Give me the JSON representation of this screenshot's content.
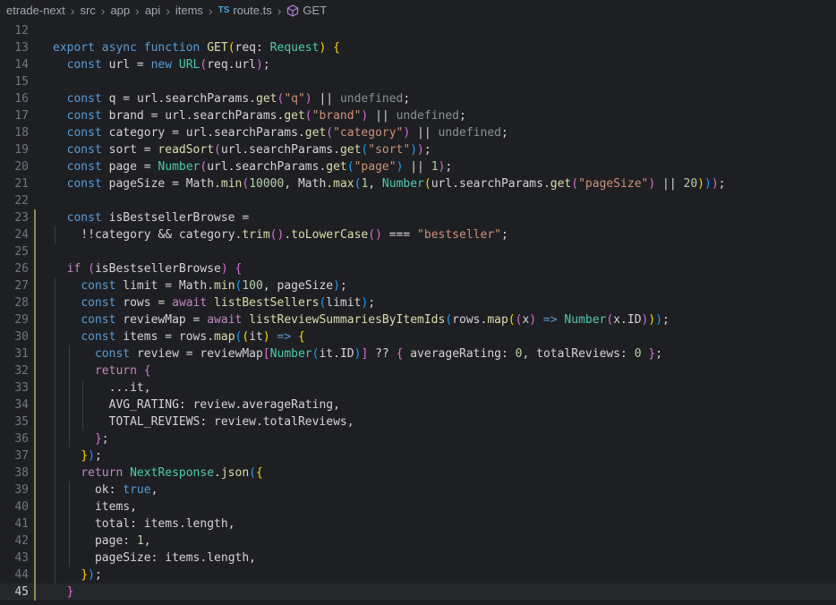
{
  "breadcrumb": {
    "segments": [
      "etrade-next",
      "src",
      "app",
      "api",
      "items",
      "route.ts",
      "GET"
    ],
    "file_badge": "TS"
  },
  "editor": {
    "current_line": 45,
    "lines": [
      {
        "n": "12",
        "tokens": []
      },
      {
        "n": "13",
        "tokens": [
          [
            "k",
            "export "
          ],
          [
            "k",
            "async "
          ],
          [
            "k",
            "function "
          ],
          [
            "f",
            "GET"
          ],
          [
            "b1",
            "("
          ],
          [
            "v",
            "req"
          ],
          [
            "o",
            ": "
          ],
          [
            "c",
            "Request"
          ],
          [
            "b1",
            ")"
          ],
          [
            "o",
            " "
          ],
          [
            "b1",
            "{"
          ]
        ]
      },
      {
        "n": "14",
        "tokens": [
          [
            "o",
            "  "
          ],
          [
            "k",
            "const "
          ],
          [
            "v",
            "url"
          ],
          [
            "o",
            " = "
          ],
          [
            "k",
            "new "
          ],
          [
            "c",
            "URL"
          ],
          [
            "b2",
            "("
          ],
          [
            "v",
            "req.url"
          ],
          [
            "b2",
            ")"
          ],
          [
            "o",
            ";"
          ]
        ]
      },
      {
        "n": "15",
        "tokens": []
      },
      {
        "n": "16",
        "tokens": [
          [
            "o",
            "  "
          ],
          [
            "k",
            "const "
          ],
          [
            "v",
            "q"
          ],
          [
            "o",
            " = "
          ],
          [
            "v",
            "url.searchParams."
          ],
          [
            "f",
            "get"
          ],
          [
            "b2",
            "("
          ],
          [
            "s",
            "\"q\""
          ],
          [
            "b2",
            ")"
          ],
          [
            "o",
            " || "
          ],
          [
            "m",
            "undefined"
          ],
          [
            "o",
            ";"
          ]
        ]
      },
      {
        "n": "17",
        "tokens": [
          [
            "o",
            "  "
          ],
          [
            "k",
            "const "
          ],
          [
            "v",
            "brand"
          ],
          [
            "o",
            " = "
          ],
          [
            "v",
            "url.searchParams."
          ],
          [
            "f",
            "get"
          ],
          [
            "b2",
            "("
          ],
          [
            "s",
            "\"brand\""
          ],
          [
            "b2",
            ")"
          ],
          [
            "o",
            " || "
          ],
          [
            "m",
            "undefined"
          ],
          [
            "o",
            ";"
          ]
        ]
      },
      {
        "n": "18",
        "tokens": [
          [
            "o",
            "  "
          ],
          [
            "k",
            "const "
          ],
          [
            "v",
            "category"
          ],
          [
            "o",
            " = "
          ],
          [
            "v",
            "url.searchParams."
          ],
          [
            "f",
            "get"
          ],
          [
            "b2",
            "("
          ],
          [
            "s",
            "\"category\""
          ],
          [
            "b2",
            ")"
          ],
          [
            "o",
            " || "
          ],
          [
            "m",
            "undefined"
          ],
          [
            "o",
            ";"
          ]
        ]
      },
      {
        "n": "19",
        "tokens": [
          [
            "o",
            "  "
          ],
          [
            "k",
            "const "
          ],
          [
            "v",
            "sort"
          ],
          [
            "o",
            " = "
          ],
          [
            "f",
            "readSort"
          ],
          [
            "b2",
            "("
          ],
          [
            "v",
            "url.searchParams."
          ],
          [
            "f",
            "get"
          ],
          [
            "b3",
            "("
          ],
          [
            "s",
            "\"sort\""
          ],
          [
            "b3",
            ")"
          ],
          [
            "b2",
            ")"
          ],
          [
            "o",
            ";"
          ]
        ]
      },
      {
        "n": "20",
        "tokens": [
          [
            "o",
            "  "
          ],
          [
            "k",
            "const "
          ],
          [
            "v",
            "page"
          ],
          [
            "o",
            " = "
          ],
          [
            "c",
            "Number"
          ],
          [
            "b2",
            "("
          ],
          [
            "v",
            "url.searchParams."
          ],
          [
            "f",
            "get"
          ],
          [
            "b3",
            "("
          ],
          [
            "s",
            "\"page\""
          ],
          [
            "b3",
            ")"
          ],
          [
            "o",
            " || "
          ],
          [
            "n",
            "1"
          ],
          [
            "b2",
            ")"
          ],
          [
            "o",
            ";"
          ]
        ]
      },
      {
        "n": "21",
        "tokens": [
          [
            "o",
            "  "
          ],
          [
            "k",
            "const "
          ],
          [
            "v",
            "pageSize"
          ],
          [
            "o",
            " = "
          ],
          [
            "v",
            "Math."
          ],
          [
            "f",
            "min"
          ],
          [
            "b2",
            "("
          ],
          [
            "n",
            "10000"
          ],
          [
            "o",
            ", "
          ],
          [
            "v",
            "Math."
          ],
          [
            "f",
            "max"
          ],
          [
            "b3",
            "("
          ],
          [
            "n",
            "1"
          ],
          [
            "o",
            ", "
          ],
          [
            "c",
            "Number"
          ],
          [
            "b1",
            "("
          ],
          [
            "v",
            "url.searchParams."
          ],
          [
            "f",
            "get"
          ],
          [
            "b2",
            "("
          ],
          [
            "s",
            "\"pageSize\""
          ],
          [
            "b2",
            ")"
          ],
          [
            "o",
            " || "
          ],
          [
            "n",
            "20"
          ],
          [
            "b1",
            ")"
          ],
          [
            "b3",
            ")"
          ],
          [
            "b2",
            ")"
          ],
          [
            "o",
            ";"
          ]
        ]
      },
      {
        "n": "22",
        "tokens": []
      },
      {
        "n": "23",
        "tokens": [
          [
            "o",
            "  "
          ],
          [
            "k",
            "const "
          ],
          [
            "v",
            "isBestsellerBrowse"
          ],
          [
            "o",
            " ="
          ]
        ]
      },
      {
        "n": "24",
        "tokens": [
          [
            "o",
            "    "
          ],
          [
            "o",
            "!!"
          ],
          [
            "v",
            "category"
          ],
          [
            "o",
            " && "
          ],
          [
            "v",
            "category."
          ],
          [
            "f",
            "trim"
          ],
          [
            "b2",
            "()"
          ],
          [
            "o",
            "."
          ],
          [
            "f",
            "toLowerCase"
          ],
          [
            "b2",
            "()"
          ],
          [
            "o",
            " === "
          ],
          [
            "s",
            "\"bestseller\""
          ],
          [
            "o",
            ";"
          ]
        ]
      },
      {
        "n": "25",
        "tokens": []
      },
      {
        "n": "26",
        "tokens": [
          [
            "o",
            "  "
          ],
          [
            "kw2",
            "if "
          ],
          [
            "b2",
            "("
          ],
          [
            "v",
            "isBestsellerBrowse"
          ],
          [
            "b2",
            ")"
          ],
          [
            "o",
            " "
          ],
          [
            "b2",
            "{"
          ]
        ]
      },
      {
        "n": "27",
        "tokens": [
          [
            "o",
            "    "
          ],
          [
            "k",
            "const "
          ],
          [
            "v",
            "limit"
          ],
          [
            "o",
            " = "
          ],
          [
            "v",
            "Math."
          ],
          [
            "f",
            "min"
          ],
          [
            "b3",
            "("
          ],
          [
            "n",
            "100"
          ],
          [
            "o",
            ", "
          ],
          [
            "v",
            "pageSize"
          ],
          [
            "b3",
            ")"
          ],
          [
            "o",
            ";"
          ]
        ]
      },
      {
        "n": "28",
        "tokens": [
          [
            "o",
            "    "
          ],
          [
            "k",
            "const "
          ],
          [
            "v",
            "rows"
          ],
          [
            "o",
            " = "
          ],
          [
            "kw2",
            "await "
          ],
          [
            "f",
            "listBestSellers"
          ],
          [
            "b3",
            "("
          ],
          [
            "v",
            "limit"
          ],
          [
            "b3",
            ")"
          ],
          [
            "o",
            ";"
          ]
        ]
      },
      {
        "n": "29",
        "tokens": [
          [
            "o",
            "    "
          ],
          [
            "k",
            "const "
          ],
          [
            "v",
            "reviewMap"
          ],
          [
            "o",
            " = "
          ],
          [
            "kw2",
            "await "
          ],
          [
            "f",
            "listReviewSummariesByItemIds"
          ],
          [
            "b3",
            "("
          ],
          [
            "v",
            "rows."
          ],
          [
            "f",
            "map"
          ],
          [
            "b1",
            "("
          ],
          [
            "b2",
            "("
          ],
          [
            "v",
            "x"
          ],
          [
            "b2",
            ")"
          ],
          [
            "k",
            " => "
          ],
          [
            "c",
            "Number"
          ],
          [
            "b2",
            "("
          ],
          [
            "v",
            "x.ID"
          ],
          [
            "b2",
            ")"
          ],
          [
            "b1",
            ")"
          ],
          [
            "b3",
            ")"
          ],
          [
            "o",
            ";"
          ]
        ]
      },
      {
        "n": "30",
        "tokens": [
          [
            "o",
            "    "
          ],
          [
            "k",
            "const "
          ],
          [
            "v",
            "items"
          ],
          [
            "o",
            " = "
          ],
          [
            "v",
            "rows."
          ],
          [
            "f",
            "map"
          ],
          [
            "b3",
            "("
          ],
          [
            "b1",
            "("
          ],
          [
            "v",
            "it"
          ],
          [
            "b1",
            ")"
          ],
          [
            "k",
            " => "
          ],
          [
            "b1",
            "{"
          ]
        ]
      },
      {
        "n": "31",
        "tokens": [
          [
            "o",
            "      "
          ],
          [
            "k",
            "const "
          ],
          [
            "v",
            "review"
          ],
          [
            "o",
            " = "
          ],
          [
            "v",
            "reviewMap"
          ],
          [
            "b2",
            "["
          ],
          [
            "c",
            "Number"
          ],
          [
            "b3",
            "("
          ],
          [
            "v",
            "it.ID"
          ],
          [
            "b3",
            ")"
          ],
          [
            "b2",
            "]"
          ],
          [
            "o",
            " ?? "
          ],
          [
            "b2",
            "{ "
          ],
          [
            "v",
            "averageRating"
          ],
          [
            "o",
            ": "
          ],
          [
            "n",
            "0"
          ],
          [
            "o",
            ", "
          ],
          [
            "v",
            "totalReviews"
          ],
          [
            "o",
            ": "
          ],
          [
            "n",
            "0"
          ],
          [
            "b2",
            " }"
          ],
          [
            "o",
            ";"
          ]
        ]
      },
      {
        "n": "32",
        "tokens": [
          [
            "o",
            "      "
          ],
          [
            "kw2",
            "return "
          ],
          [
            "b2",
            "{"
          ]
        ]
      },
      {
        "n": "33",
        "tokens": [
          [
            "o",
            "        "
          ],
          [
            "o",
            "..."
          ],
          [
            "v",
            "it"
          ],
          [
            "o",
            ","
          ]
        ]
      },
      {
        "n": "34",
        "tokens": [
          [
            "o",
            "        "
          ],
          [
            "v",
            "AVG_RATING"
          ],
          [
            "o",
            ": "
          ],
          [
            "v",
            "review.averageRating"
          ],
          [
            "o",
            ","
          ]
        ]
      },
      {
        "n": "35",
        "tokens": [
          [
            "o",
            "        "
          ],
          [
            "v",
            "TOTAL_REVIEWS"
          ],
          [
            "o",
            ": "
          ],
          [
            "v",
            "review.totalReviews"
          ],
          [
            "o",
            ","
          ]
        ]
      },
      {
        "n": "36",
        "tokens": [
          [
            "o",
            "      "
          ],
          [
            "b2",
            "}"
          ],
          [
            "o",
            ";"
          ]
        ]
      },
      {
        "n": "37",
        "tokens": [
          [
            "o",
            "    "
          ],
          [
            "b1",
            "}"
          ],
          [
            "b3",
            ")"
          ],
          [
            "o",
            ";"
          ]
        ]
      },
      {
        "n": "38",
        "tokens": [
          [
            "o",
            "    "
          ],
          [
            "kw2",
            "return "
          ],
          [
            "c",
            "NextResponse"
          ],
          [
            "o",
            "."
          ],
          [
            "f",
            "json"
          ],
          [
            "b3",
            "("
          ],
          [
            "b1",
            "{"
          ]
        ]
      },
      {
        "n": "39",
        "tokens": [
          [
            "o",
            "      "
          ],
          [
            "v",
            "ok"
          ],
          [
            "o",
            ": "
          ],
          [
            "k",
            "true"
          ],
          [
            "o",
            ","
          ]
        ]
      },
      {
        "n": "40",
        "tokens": [
          [
            "o",
            "      "
          ],
          [
            "v",
            "items"
          ],
          [
            "o",
            ","
          ]
        ]
      },
      {
        "n": "41",
        "tokens": [
          [
            "o",
            "      "
          ],
          [
            "v",
            "total"
          ],
          [
            "o",
            ": "
          ],
          [
            "v",
            "items.length"
          ],
          [
            "o",
            ","
          ]
        ]
      },
      {
        "n": "42",
        "tokens": [
          [
            "o",
            "      "
          ],
          [
            "v",
            "page"
          ],
          [
            "o",
            ": "
          ],
          [
            "n",
            "1"
          ],
          [
            "o",
            ","
          ]
        ]
      },
      {
        "n": "43",
        "tokens": [
          [
            "o",
            "      "
          ],
          [
            "v",
            "pageSize"
          ],
          [
            "o",
            ": "
          ],
          [
            "v",
            "items.length"
          ],
          [
            "o",
            ","
          ]
        ]
      },
      {
        "n": "44",
        "tokens": [
          [
            "o",
            "    "
          ],
          [
            "b1",
            "}"
          ],
          [
            "b3",
            ")"
          ],
          [
            "o",
            ";"
          ]
        ]
      },
      {
        "n": "45",
        "tokens": [
          [
            "o",
            "  "
          ],
          [
            "b2",
            "}"
          ]
        ]
      }
    ],
    "modified_lines": [
      "23",
      "24",
      "25",
      "26",
      "27",
      "28",
      "29",
      "30",
      "31",
      "32",
      "33",
      "34",
      "35",
      "36",
      "37",
      "38",
      "39",
      "40",
      "41",
      "42",
      "43",
      "44",
      "45"
    ]
  }
}
